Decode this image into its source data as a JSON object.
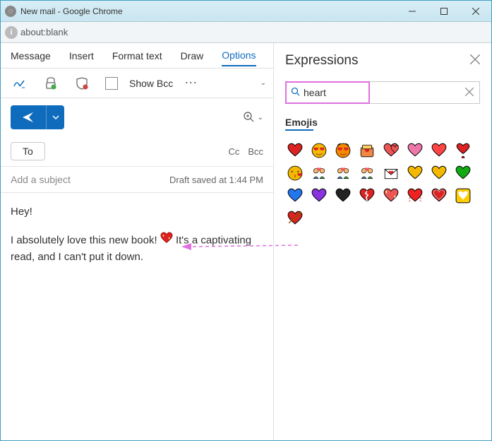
{
  "window": {
    "title": "New mail - Google Chrome"
  },
  "address": {
    "url": "about:blank"
  },
  "tabs": [
    "Message",
    "Insert",
    "Format text",
    "Draw",
    "Options"
  ],
  "active_tab": 4,
  "toolbar": {
    "show_bcc_label": "Show Bcc"
  },
  "to": {
    "button": "To",
    "cc": "Cc",
    "bcc": "Bcc"
  },
  "subject": {
    "placeholder": "Add a subject",
    "draft_status": "Draft saved at 1:44 PM"
  },
  "body": {
    "line1": "Hey!",
    "line2a": "I absolutely love this new book! ",
    "line2b": " It's a captivating read, and I can't put it down."
  },
  "panel": {
    "title": "Expressions",
    "search_value": "heart",
    "category": "Emojis"
  },
  "emoji_names": [
    "red-heart",
    "heart-eyes-face",
    "heart-eyes-cat",
    "heart-gift",
    "two-hearts",
    "pink-heart",
    "orange-heart",
    "heart-exclamation",
    "kissing-face",
    "couple-heart",
    "family-heart",
    "couple-heart-2",
    "love-letter",
    "yellow-heart",
    "yellow-heart-2",
    "green-heart",
    "blue-heart",
    "purple-heart",
    "black-heart",
    "broken-heart",
    "sparkling-heart",
    "beating-heart",
    "growing-heart",
    "heart-decoration",
    "heart-arrow"
  ],
  "emoji_styles": [
    {
      "fill": "#d22",
      "stroke": "#000"
    },
    {
      "face": "#f5b800",
      "eyes": "heart"
    },
    {
      "face": "#f58800",
      "eyes": "heart",
      "cat": true
    },
    {
      "fill": "#e84",
      "stroke": "#000",
      "box": true
    },
    {
      "fill": "#e55",
      "double": true
    },
    {
      "fill": "#e7a",
      "stroke": "#000"
    },
    {
      "fill": "#f44",
      "stroke": "#000"
    },
    {
      "fill": "#d22",
      "stroke": "#000",
      "excl": true
    },
    {
      "face": "#f5b800",
      "kiss": true
    },
    {
      "fill": "#e55",
      "people": true
    },
    {
      "fill": "#e55",
      "people": true
    },
    {
      "fill": "#e55",
      "people": true
    },
    {
      "envelope": true
    },
    {
      "fill": "#f5b800",
      "stroke": "#000"
    },
    {
      "fill": "#f5b800",
      "stroke": "#000"
    },
    {
      "fill": "#1a1",
      "stroke": "#000"
    },
    {
      "fill": "#27e",
      "stroke": "#000"
    },
    {
      "fill": "#83d",
      "stroke": "#000"
    },
    {
      "fill": "#222",
      "stroke": "#000"
    },
    {
      "fill": "#d22",
      "stroke": "#000",
      "broken": true
    },
    {
      "fill": "#e55",
      "stroke": "#000",
      "spark": true
    },
    {
      "fill": "#e22",
      "stroke": "#000",
      "beat": true
    },
    {
      "fill": "#d22",
      "stroke": "#000",
      "grow": true
    },
    {
      "fill": "#fc0",
      "stroke": "#000",
      "deco": true
    },
    {
      "fill": "#d22",
      "stroke": "#000",
      "arrow": true
    }
  ]
}
